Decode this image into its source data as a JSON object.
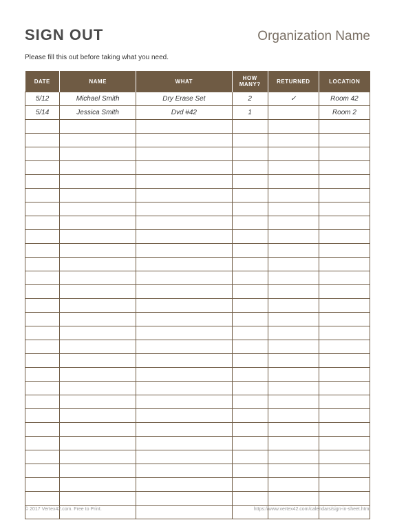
{
  "header": {
    "title": "SIGN OUT",
    "org": "Organization Name"
  },
  "instruction": "Please fill this out before taking what you need.",
  "columns": {
    "date": "DATE",
    "name": "NAME",
    "what": "WHAT",
    "howmany": "HOW MANY?",
    "returned": "RETURNED",
    "location": "LOCATION"
  },
  "rows": [
    {
      "date": "5/12",
      "name": "Michael Smith",
      "what": "Dry Erase Set",
      "howmany": "2",
      "returned": "✓",
      "location": "Room 42"
    },
    {
      "date": "5/14",
      "name": "Jessica Smith",
      "what": "Dvd #42",
      "howmany": "1",
      "returned": "",
      "location": "Room 2"
    }
  ],
  "empty_row_count": 29,
  "footer": {
    "left": "© 2017 Vertex42.com. Free to Print.",
    "right": "https://www.vertex42.com/calendars/sign-in-sheet.html"
  }
}
